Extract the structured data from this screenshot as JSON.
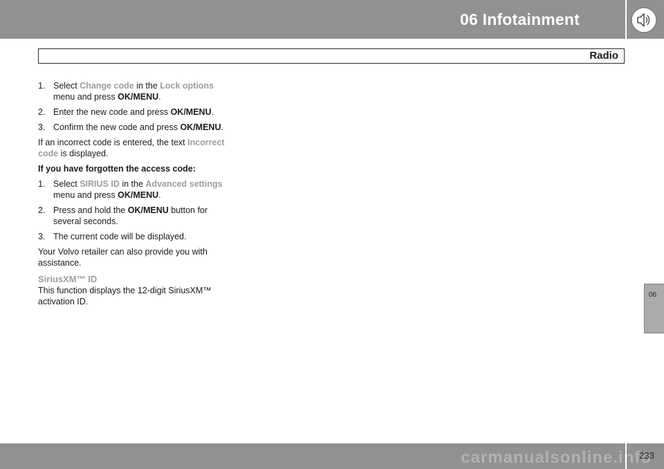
{
  "header": {
    "chapter_title": "06 Infotainment",
    "icon": "speaker-icon"
  },
  "section": {
    "title": "Radio"
  },
  "content": {
    "steps_change": [
      {
        "num": "1.",
        "t1": "Select ",
        "h1": "Change code",
        "t2": " in the ",
        "h2": "Lock options",
        "t3": " menu and press ",
        "b1": "OK/MENU",
        "t4": "."
      },
      {
        "num": "2.",
        "t1": "Enter the new code and press ",
        "b1": "OK/MENU",
        "t2": "."
      },
      {
        "num": "3.",
        "t1": "Confirm the new code and press ",
        "b1": "OK/MENU",
        "t2": "."
      }
    ],
    "incorrect": {
      "t1": "If an incorrect code is entered, the text ",
      "h1": "Incorrect code",
      "t2": " is displayed."
    },
    "forgotten_heading": "If you have forgotten the access code:",
    "steps_forgot": [
      {
        "num": "1.",
        "t1": "Select ",
        "h1": "SIRIUS ID",
        "t2": " in the ",
        "h2": "Advanced settings",
        "t3": " menu and press ",
        "b1": "OK/MENU",
        "t4": "."
      },
      {
        "num": "2.",
        "t1": "Press and hold the ",
        "b1": "OK/MENU",
        "t2": " button for several seconds."
      },
      {
        "num": "3.",
        "text": "The current code will be displayed."
      }
    ],
    "retailer_text": "Your Volvo retailer can also provide you with assistance.",
    "siriusxm_heading": "SiriusXM™ ID",
    "siriusxm_text": "This function displays the 12-digit SiriusXM™ activation ID."
  },
  "side_tab": {
    "label": "06"
  },
  "footer": {
    "page_number": "233",
    "watermark": "carmanualsonline.info"
  },
  "colors": {
    "bar": "#8f9193",
    "highlight": "#9a9c9f",
    "tab": "#a9abad"
  }
}
